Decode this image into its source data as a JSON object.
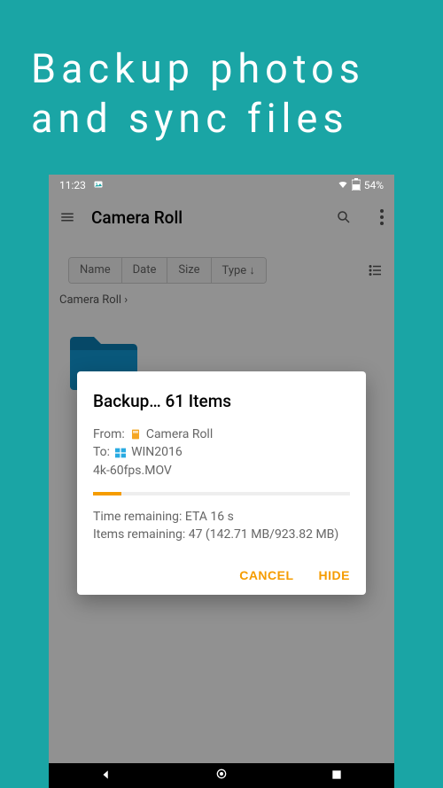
{
  "hero": {
    "line1": "Backup photos",
    "line2": "and sync files"
  },
  "status": {
    "time": "11:23",
    "battery": "54%"
  },
  "app": {
    "title": "Camera Roll"
  },
  "sort": {
    "name": "Name",
    "date": "Date",
    "size": "Size",
    "type": "Type ↓"
  },
  "breadcrumb": "Camera Roll ›",
  "dialog": {
    "title": "Backup… 61 Items",
    "from_label": "From:",
    "from_value": "Camera Roll",
    "to_label": "To:",
    "to_value": "WIN2016",
    "current_file": "4k-60fps.MOV",
    "eta": "Time remaining: ETA 16 s",
    "items": "Items remaining: 47 (142.71 MB/923.82 MB)",
    "cancel": "CANCEL",
    "hide": "HIDE"
  }
}
